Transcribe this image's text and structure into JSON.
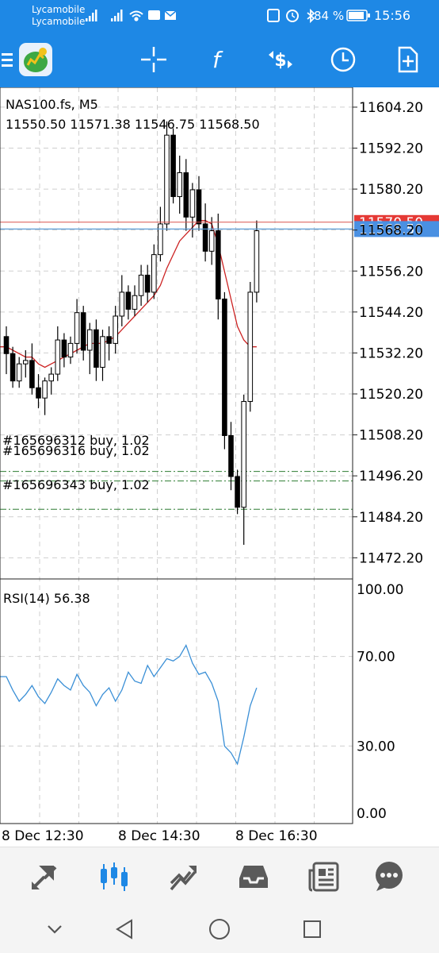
{
  "status": {
    "carrier1": "Lycamobile",
    "carrier2": "Lycamobile",
    "battery": "84 %",
    "time": "15:56"
  },
  "toolbar": {
    "icons": [
      "menu-icon",
      "app-logo-icon",
      "crosshair-icon",
      "indicators-icon",
      "trade-icon",
      "timeframe-icon",
      "add-object-icon"
    ]
  },
  "chart": {
    "symbol_label": "NAS100.fs, M5",
    "ohlc_label": "11550.50 11571.38 11546.75 11568.50",
    "price_ticks": [
      "11604.20",
      "11592.20",
      "11580.20",
      "11568.20",
      "11556.20",
      "11544.20",
      "11532.20",
      "11520.20",
      "11508.20",
      "11496.20",
      "11484.20",
      "11472.20"
    ],
    "bid_label": "11568.50",
    "ask_label": "11570.50",
    "orders": [
      "#165696312 buy, 1.02",
      "#165696316 buy, 1.02",
      "#165696343 buy, 1.02"
    ],
    "rsi_label": "RSI(14) 56.38",
    "rsi_ticks": [
      "100.00",
      "70.00",
      "30.00",
      "0.00"
    ],
    "time_ticks": [
      "8 Dec 12:30",
      "8 Dec 14:30",
      "8 Dec 16:30"
    ],
    "colors": {
      "bid_line": "#5b9bd5",
      "ask_line": "#d9534f",
      "ma_line": "#cc2222",
      "rsi_line": "#3a8fd6",
      "order_line": "#2e7d32",
      "toolbar_bg": "#1e88e5"
    }
  },
  "bottom_nav": {
    "items": [
      "quotes-icon",
      "chart-icon",
      "trade-icon",
      "history-icon",
      "news-icon",
      "chat-icon"
    ],
    "active": "chart-icon"
  },
  "system_nav": {
    "items": [
      "collapse-icon",
      "back-icon",
      "home-icon",
      "recents-icon"
    ]
  },
  "chart_data": {
    "type": "candlestick",
    "x": [
      "8 Dec 12:30",
      "8 Dec 14:30",
      "8 Dec 16:30"
    ],
    "ylim": [
      11466,
      11610
    ],
    "candles": [
      [
        11537,
        11540,
        11526,
        11532
      ],
      [
        11532,
        11534,
        11522,
        11524
      ],
      [
        11524,
        11531,
        11522,
        11529
      ],
      [
        11529,
        11533,
        11525,
        11530
      ],
      [
        11530,
        11535,
        11520,
        11522
      ],
      [
        11522,
        11526,
        11516,
        11519
      ],
      [
        11519,
        11525,
        11514,
        11524
      ],
      [
        11524,
        11528,
        11520,
        11526
      ],
      [
        11526,
        11540,
        11524,
        11536
      ],
      [
        11536,
        11538,
        11528,
        11531
      ],
      [
        11531,
        11537,
        11529,
        11535
      ],
      [
        11535,
        11548,
        11532,
        11544
      ],
      [
        11544,
        11546,
        11530,
        11533
      ],
      [
        11533,
        11541,
        11526,
        11539
      ],
      [
        11539,
        11542,
        11524,
        11528
      ],
      [
        11528,
        11539,
        11524,
        11537
      ],
      [
        11537,
        11540,
        11530,
        11535
      ],
      [
        11535,
        11546,
        11532,
        11543
      ],
      [
        11543,
        11555,
        11540,
        11550
      ],
      [
        11550,
        11552,
        11542,
        11545
      ],
      [
        11545,
        11552,
        11543,
        11549
      ],
      [
        11549,
        11558,
        11546,
        11555
      ],
      [
        11555,
        11558,
        11547,
        11550
      ],
      [
        11550,
        11564,
        11548,
        11561
      ],
      [
        11561,
        11575,
        11559,
        11570
      ],
      [
        11570,
        11600,
        11568,
        11596
      ],
      [
        11596,
        11598,
        11576,
        11578
      ],
      [
        11578,
        11590,
        11573,
        11585
      ],
      [
        11585,
        11589,
        11568,
        11572
      ],
      [
        11572,
        11582,
        11566,
        11580
      ],
      [
        11580,
        11584,
        11568,
        11570
      ],
      [
        11570,
        11576,
        11559,
        11562
      ],
      [
        11562,
        11572,
        11558,
        11568
      ],
      [
        11568,
        11573,
        11542,
        11548
      ],
      [
        11548,
        11550,
        11504,
        11508
      ],
      [
        11508,
        11512,
        11492,
        11496
      ],
      [
        11496,
        11498,
        11485,
        11487
      ],
      [
        11487,
        11520,
        11476,
        11518
      ],
      [
        11518,
        11553,
        11515,
        11550
      ],
      [
        11550,
        11571,
        11547,
        11568
      ]
    ],
    "ma": [
      11534,
      11533,
      11532,
      11531,
      11531,
      11529,
      11528,
      11529,
      11530,
      11531,
      11532,
      11533,
      11534,
      11535,
      11535,
      11535,
      11536,
      11537,
      11539,
      11541,
      11543,
      11545,
      11547,
      11549,
      11552,
      11557,
      11561,
      11565,
      11567,
      11569,
      11571,
      11571,
      11570,
      11564,
      11556,
      11548,
      11540,
      11536,
      11534,
      11534
    ],
    "rsi": [
      61,
      55,
      50,
      53,
      57,
      52,
      49,
      54,
      60,
      57,
      55,
      62,
      57,
      54,
      48,
      53,
      56,
      50,
      55,
      63,
      59,
      58,
      66,
      61,
      65,
      69,
      68,
      70,
      75,
      67,
      62,
      63,
      58,
      50,
      30,
      27,
      22,
      34,
      48,
      56
    ],
    "rsi_ylim": [
      0,
      100
    ],
    "bid": 11568.5,
    "ask": 11570.5,
    "order_prices": [
      11497.5,
      11494.7,
      11486.4
    ]
  }
}
